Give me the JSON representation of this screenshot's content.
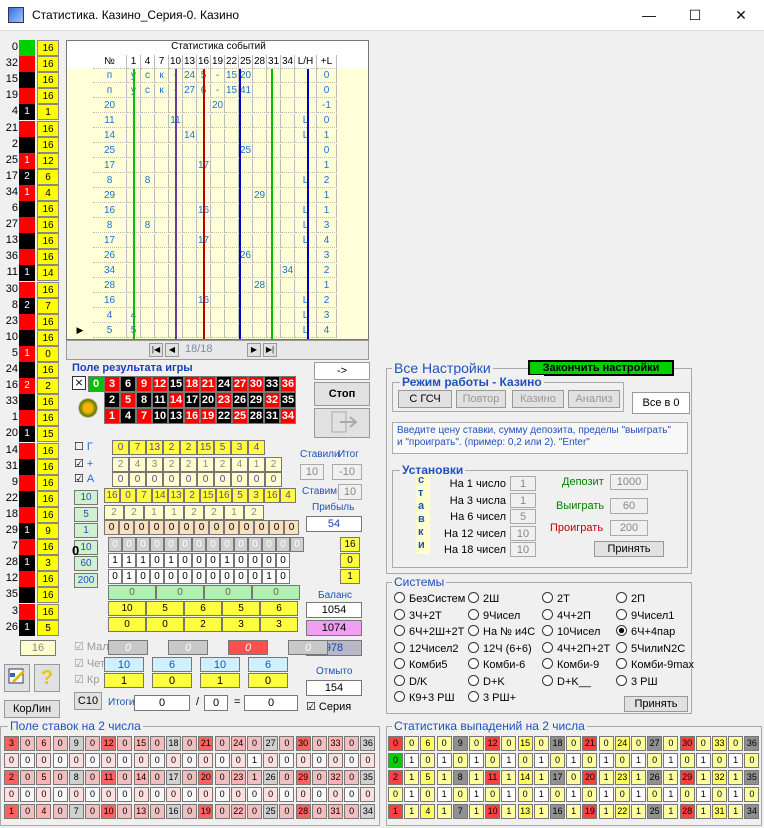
{
  "window": {
    "title": "Статистика. Казино_Серия-0. Казино",
    "min": "—",
    "max": "☐",
    "close": "✕"
  },
  "left_column": [
    {
      "n": "0",
      "c": "grn",
      "v": "16"
    },
    {
      "n": "32",
      "c": "red",
      "v": "16"
    },
    {
      "n": "15",
      "c": "blk",
      "v": "16"
    },
    {
      "n": "19",
      "c": "red",
      "v": "16"
    },
    {
      "n": "4",
      "c": "blk",
      "cl": "1",
      "v": "1"
    },
    {
      "n": "21",
      "c": "red",
      "v": "16"
    },
    {
      "n": "2",
      "c": "blk",
      "v": "16"
    },
    {
      "n": "25",
      "c": "red",
      "cl": "1",
      "v": "12"
    },
    {
      "n": "17",
      "c": "blk",
      "cl": "2",
      "v": "6"
    },
    {
      "n": "34",
      "c": "red",
      "cl": "1",
      "v": "4"
    },
    {
      "n": "6",
      "c": "blk",
      "v": "16"
    },
    {
      "n": "27",
      "c": "red",
      "v": "16"
    },
    {
      "n": "13",
      "c": "blk",
      "v": "16"
    },
    {
      "n": "36",
      "c": "red",
      "v": "16"
    },
    {
      "n": "11",
      "c": "blk",
      "cl": "1",
      "v": "14"
    },
    {
      "n": "30",
      "c": "red",
      "v": "16"
    },
    {
      "n": "8",
      "c": "blk",
      "cl": "2",
      "v": "7"
    },
    {
      "n": "23",
      "c": "red",
      "v": "16"
    },
    {
      "n": "10",
      "c": "blk",
      "v": "16"
    },
    {
      "n": "5",
      "c": "red",
      "cl": "1",
      "v": "0"
    },
    {
      "n": "24",
      "c": "blk",
      "v": "16"
    },
    {
      "n": "16",
      "c": "red",
      "cl": "2",
      "v": "2"
    },
    {
      "n": "33",
      "c": "blk",
      "v": "16"
    },
    {
      "n": "1",
      "c": "red",
      "v": "16"
    },
    {
      "n": "20",
      "c": "blk",
      "cl": "1",
      "v": "15"
    },
    {
      "n": "14",
      "c": "red",
      "v": "16"
    },
    {
      "n": "31",
      "c": "blk",
      "v": "16"
    },
    {
      "n": "9",
      "c": "red",
      "v": "16"
    },
    {
      "n": "22",
      "c": "blk",
      "v": "16"
    },
    {
      "n": "18",
      "c": "red",
      "v": "16"
    },
    {
      "n": "29",
      "c": "blk",
      "cl": "1",
      "v": "9"
    },
    {
      "n": "7",
      "c": "red",
      "v": "16"
    },
    {
      "n": "28",
      "c": "blk",
      "cl": "1",
      "v": "3"
    },
    {
      "n": "12",
      "c": "red",
      "v": "16"
    },
    {
      "n": "35",
      "c": "blk",
      "v": "16"
    },
    {
      "n": "3",
      "c": "red",
      "v": "16"
    },
    {
      "n": "26",
      "c": "blk",
      "cl": "1",
      "v": "5"
    }
  ],
  "left_bottom_value": "16",
  "stats": {
    "title": "Статистика событий",
    "headers": [
      "№",
      "1",
      "4",
      "7",
      "10",
      "13",
      "16",
      "19",
      "22",
      "25",
      "28",
      "31",
      "34",
      "L/H",
      "+L"
    ],
    "rows": [
      [
        "п",
        "у",
        "с",
        "к",
        "-",
        "24",
        "5",
        "-",
        "15",
        "20",
        "",
        "",
        "",
        "",
        "0"
      ],
      [
        "п",
        "у",
        "с",
        "к",
        "-",
        "27",
        "6",
        "-",
        "15",
        "41",
        "",
        "",
        "",
        "",
        "0"
      ],
      [
        "20",
        "",
        "",
        "",
        "",
        "",
        "",
        "20",
        "",
        "",
        "",
        "",
        "",
        "",
        "-1"
      ],
      [
        "11",
        "",
        "",
        "",
        "11",
        "",
        "",
        "",
        "",
        "",
        "",
        "",
        "",
        "L",
        "0"
      ],
      [
        "14",
        "",
        "",
        "",
        "",
        "14",
        "",
        "",
        "",
        "",
        "",
        "",
        "",
        "L",
        "1"
      ],
      [
        "25",
        "",
        "",
        "",
        "",
        "",
        "",
        "",
        "",
        "25",
        "",
        "",
        "",
        "",
        "0"
      ],
      [
        "17",
        "",
        "",
        "",
        "",
        "",
        "17",
        "",
        "",
        "",
        "",
        "",
        "",
        "",
        "1"
      ],
      [
        "8",
        "",
        "8",
        "",
        "",
        "",
        "",
        "",
        "",
        "",
        "",
        "",
        "",
        "L",
        "2"
      ],
      [
        "29",
        "",
        "",
        "",
        "",
        "",
        "",
        "",
        "",
        "",
        "29",
        "",
        "",
        "",
        "1"
      ],
      [
        "16",
        "",
        "",
        "",
        "",
        "",
        "16",
        "",
        "",
        "",
        "",
        "",
        "",
        "L",
        "1"
      ],
      [
        "8",
        "",
        "8",
        "",
        "",
        "",
        "",
        "",
        "",
        "",
        "",
        "",
        "",
        "L",
        "3"
      ],
      [
        "17",
        "",
        "",
        "",
        "",
        "",
        "17",
        "",
        "",
        "",
        "",
        "",
        "",
        "L",
        "4"
      ],
      [
        "26",
        "",
        "",
        "",
        "",
        "",
        "",
        "",
        "",
        "26",
        "",
        "",
        "",
        "",
        "3"
      ],
      [
        "34",
        "",
        "",
        "",
        "",
        "",
        "",
        "",
        "",
        "",
        "",
        "",
        "34",
        "",
        "2"
      ],
      [
        "28",
        "",
        "",
        "",
        "",
        "",
        "",
        "",
        "",
        "",
        "28",
        "",
        "",
        "",
        "1"
      ],
      [
        "16",
        "",
        "",
        "",
        "",
        "",
        "16",
        "",
        "",
        "",
        "",
        "",
        "",
        "L",
        "2"
      ],
      [
        "4",
        "4",
        "",
        "",
        "",
        "",
        "",
        "",
        "",
        "",
        "",
        "",
        "",
        "L",
        "3"
      ],
      [
        "5",
        "5",
        "",
        "",
        "",
        "",
        "",
        "",
        "",
        "",
        "",
        "",
        "",
        "L",
        "4"
      ]
    ],
    "position": "18/18"
  },
  "nav": {
    "first": "|◀",
    "prev": "◀",
    "next": "▶",
    "last": "▶|"
  },
  "arrow_button": "->",
  "stop_button": "Стоп",
  "result_field": {
    "title": "Поле результата игры",
    "row1": [
      [
        "0",
        "g"
      ],
      [
        "3",
        "r"
      ],
      [
        "6",
        "k"
      ],
      [
        "9",
        "r"
      ],
      [
        "12",
        "r"
      ],
      [
        "15",
        "k"
      ],
      [
        "18",
        "r"
      ],
      [
        "21",
        "r"
      ],
      [
        "24",
        "k"
      ],
      [
        "27",
        "r"
      ],
      [
        "30",
        "r"
      ],
      [
        "33",
        "k"
      ],
      [
        "36",
        "r"
      ]
    ],
    "row2": [
      [
        "2",
        "k"
      ],
      [
        "5",
        "r"
      ],
      [
        "8",
        "k"
      ],
      [
        "11",
        "k"
      ],
      [
        "14",
        "r"
      ],
      [
        "17",
        "k"
      ],
      [
        "20",
        "k"
      ],
      [
        "23",
        "r"
      ],
      [
        "26",
        "k"
      ],
      [
        "29",
        "k"
      ],
      [
        "32",
        "r"
      ],
      [
        "35",
        "k"
      ]
    ],
    "row3": [
      [
        "1",
        "r"
      ],
      [
        "4",
        "k"
      ],
      [
        "7",
        "r"
      ],
      [
        "10",
        "k"
      ],
      [
        "13",
        "k"
      ],
      [
        "16",
        "r"
      ],
      [
        "19",
        "r"
      ],
      [
        "22",
        "k"
      ],
      [
        "25",
        "r"
      ],
      [
        "28",
        "k"
      ],
      [
        "31",
        "k"
      ],
      [
        "34",
        "r"
      ]
    ]
  },
  "checks": {
    "g": "Г",
    "plus": "+",
    "a": "А"
  },
  "mid_rows": {
    "r1": [
      "0",
      "7",
      "13",
      "2",
      "2",
      "15",
      "5",
      "3",
      "4"
    ],
    "r2": [
      "2",
      "4",
      "3",
      "2",
      "2",
      "1",
      "2",
      "4",
      "1",
      "2"
    ],
    "r3": [
      "0",
      "0",
      "0",
      "0",
      "0",
      "0",
      "0",
      "0",
      "0",
      "0"
    ],
    "r4": [
      "16",
      "0",
      "7",
      "14",
      "13",
      "2",
      "15",
      "16",
      "5",
      "3",
      "16",
      "4"
    ],
    "r5": [
      "2",
      "2",
      "1",
      "1",
      "2",
      "2",
      "1",
      "2"
    ],
    "r6": [
      "0",
      "0",
      "0",
      "0",
      "0",
      "0",
      "0",
      "0",
      "0",
      "0",
      "0",
      "0",
      "0"
    ],
    "g1": [
      "0",
      "0",
      "0",
      "0",
      "0",
      "0",
      "0",
      "0",
      "0",
      "0",
      "0",
      "0",
      "0",
      "0"
    ],
    "g2": [
      "1",
      "1",
      "1",
      "0",
      "1",
      "0",
      "0",
      "0",
      "1",
      "0",
      "0",
      "0",
      "0"
    ],
    "g3": [
      "0",
      "1",
      "0",
      "0",
      "0",
      "0",
      "0",
      "0",
      "0",
      "0",
      "0",
      "1",
      "0"
    ],
    "side": [
      "16",
      "0",
      "1"
    ],
    "b1": [
      "0",
      "0",
      "0",
      "0"
    ],
    "y1": [
      "10",
      "5",
      "6",
      "5",
      "6"
    ],
    "y2": [
      "0",
      "0",
      "2",
      "3",
      "3"
    ],
    "leftnums": [
      "10",
      "5",
      "1",
      "10",
      "60",
      "200"
    ],
    "zero": "0"
  },
  "stake": {
    "stavili": "Ставили",
    "itog": "Итог",
    "v1": "10",
    "v2": "-10",
    "staviim": "Ставим:",
    "v3": "10",
    "pribyl": "Прибыль",
    "v4": "54",
    "balans": "Баланс",
    "b1": "1054",
    "b2": "1074",
    "b3": "978",
    "otmyto": "Отмыто",
    "o1": "154",
    "seria": "Серия"
  },
  "low": {
    "mal": "Мал",
    "chet": "Чет",
    "kr": "Кр",
    "gray": [
      "0",
      "0",
      "0",
      "0"
    ],
    "r1": [
      "10",
      "6",
      "10",
      "6"
    ],
    "r2": [
      "1",
      "0",
      "1",
      "0"
    ],
    "c10": "С10",
    "itogi": "Итоги:",
    "i1": "0",
    "slash": "/",
    "i2": "0",
    "eq": "=",
    "i3": "0",
    "korlin": "КорЛин"
  },
  "settings": {
    "title": "Все Настройки",
    "finish": "Закончить настройки",
    "mode_title": "Режим работы - Казино",
    "b_gsch": "С ГСЧ",
    "b_povtor": "Повтор",
    "b_kazino": "Казино",
    "b_analiz": "Анализ",
    "b_all0": "Все в 0",
    "hint": "Введите цену ставки, сумму депозита, пределы \"выиграть\" и \"проиграть\". (пример: 0,2 или 2). \"Enter\"",
    "inst_title": "Установки",
    "stavki": [
      "с",
      "т",
      "а",
      "в",
      "к",
      "и"
    ],
    "rows": [
      {
        "l": "На 1 число",
        "v": "1"
      },
      {
        "l": "На 3 числа",
        "v": "1"
      },
      {
        "l": "На 6 чисел",
        "v": "5"
      },
      {
        "l": "На 12 чисел",
        "v": "10"
      },
      {
        "l": "На 18 чисел",
        "v": "10"
      }
    ],
    "deposit": "Депозит",
    "dv": "1000",
    "win": "Выиграть",
    "wv": "60",
    "lose": "Проиграть",
    "lv": "200",
    "accept": "Принять"
  },
  "systems": {
    "title": "Системы",
    "items": [
      "БезСистем",
      "2Ш",
      "2Т",
      "2П",
      "3Ч+2Т",
      "9Чисел",
      "4Ч+2П",
      "9Чисел1",
      "6Ч+2Ш+2Т",
      "На № и4С",
      "10Чисел",
      "6Ч+4пар",
      "12Чисел2",
      "12Ч (6+6)",
      "4Ч+2П+2Т",
      "5ЧилиN2C",
      "Комби5",
      "Комби-6",
      "Комби-9",
      "Комби-9max",
      "D/K",
      "D+K",
      "D+K__",
      "3 РШ",
      "К9+3 РШ",
      "3 РШ+"
    ],
    "selected": "6Ч+4пар",
    "accept": "Принять"
  },
  "bets": {
    "title": "Поле ставок на 2 числа",
    "r1": [
      "3",
      "0",
      "6",
      "0",
      "9",
      "0",
      "12",
      "0",
      "15",
      "0",
      "18",
      "0",
      "21",
      "0",
      "24",
      "0",
      "27",
      "0",
      "30",
      "0",
      "33",
      "0",
      "36"
    ],
    "r2": [
      "0",
      "0",
      "0",
      "0",
      "0",
      "0",
      "0",
      "0",
      "0",
      "0",
      "0",
      "0",
      "0",
      "0",
      "0",
      "1",
      "0",
      "0",
      "0",
      "0",
      "0",
      "0",
      "0"
    ],
    "r3": [
      "2",
      "0",
      "5",
      "0",
      "8",
      "0",
      "11",
      "0",
      "14",
      "0",
      "17",
      "0",
      "20",
      "0",
      "23",
      "1",
      "26",
      "0",
      "29",
      "0",
      "32",
      "0",
      "35"
    ],
    "r4": [
      "0",
      "0",
      "0",
      "0",
      "0",
      "0",
      "0",
      "0",
      "0",
      "0",
      "0",
      "0",
      "0",
      "0",
      "0",
      "0",
      "0",
      "0",
      "0",
      "0",
      "0",
      "0",
      "0"
    ],
    "r5": [
      "1",
      "0",
      "4",
      "0",
      "7",
      "0",
      "10",
      "0",
      "13",
      "0",
      "16",
      "0",
      "19",
      "0",
      "22",
      "0",
      "25",
      "0",
      "28",
      "0",
      "31",
      "0",
      "34"
    ]
  },
  "drops": {
    "title": "Статистика выпадений на 2 числа",
    "r1": [
      "0",
      "0",
      "6",
      "0",
      "9",
      "0",
      "12",
      "0",
      "15",
      "0",
      "18",
      "0",
      "21",
      "0",
      "24",
      "0",
      "27",
      "0",
      "30",
      "0",
      "33",
      "0",
      "36"
    ],
    "r2": [
      "0",
      "1",
      "0",
      "1",
      "0",
      "1",
      "0",
      "1",
      "0",
      "1",
      "0",
      "1",
      "0",
      "1",
      "0",
      "1",
      "0",
      "1",
      "0",
      "1",
      "0",
      "1",
      "0"
    ],
    "r3": [
      "2",
      "1",
      "5",
      "1",
      "8",
      "1",
      "11",
      "1",
      "14",
      "1",
      "17",
      "0",
      "20",
      "1",
      "23",
      "1",
      "26",
      "1",
      "29",
      "1",
      "32",
      "1",
      "35"
    ],
    "r4": [
      "0",
      "1",
      "0",
      "1",
      "0",
      "1",
      "0",
      "1",
      "0",
      "1",
      "0",
      "1",
      "0",
      "1",
      "0",
      "1",
      "0",
      "1",
      "0",
      "1",
      "0",
      "1",
      "0"
    ],
    "r5": [
      "1",
      "1",
      "4",
      "1",
      "7",
      "1",
      "10",
      "1",
      "13",
      "1",
      "16",
      "1",
      "19",
      "1",
      "22",
      "1",
      "25",
      "1",
      "28",
      "1",
      "31",
      "1",
      "34"
    ]
  }
}
